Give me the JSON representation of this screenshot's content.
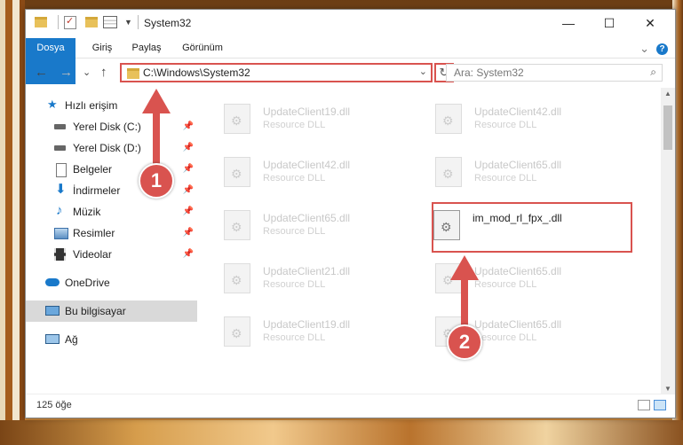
{
  "window": {
    "title": "System32",
    "minimize": "—",
    "maximize": "☐",
    "close": "✕"
  },
  "ribbon": {
    "tabs": [
      "Dosya",
      "Giriş",
      "Paylaş",
      "Görünüm"
    ],
    "expand": "⌄",
    "help": "?"
  },
  "nav": {
    "back": "←",
    "forward": "→",
    "recent": "⌄",
    "up": "↑",
    "address_path": "C:\\Windows\\System32",
    "dropdown": "⌄",
    "refresh": "↻",
    "search_placeholder": "Ara: System32",
    "search_icon": "⌕"
  },
  "sidebar": {
    "items": [
      {
        "label": "Hızlı erişim",
        "icon": "star-icon"
      },
      {
        "label": "Yerel Disk (C:)",
        "icon": "drive-icon",
        "pinned": true
      },
      {
        "label": "Yerel Disk (D:)",
        "icon": "drive-icon",
        "pinned": true
      },
      {
        "label": "Belgeler",
        "icon": "documents-icon",
        "pinned": true
      },
      {
        "label": "İndirmeler",
        "icon": "download-icon",
        "pinned": true
      },
      {
        "label": "Müzik",
        "icon": "music-icon",
        "pinned": true
      },
      {
        "label": "Resimler",
        "icon": "pictures-icon",
        "pinned": true
      },
      {
        "label": "Videolar",
        "icon": "videos-icon",
        "pinned": true
      },
      {
        "label": "OneDrive",
        "icon": "cloud-icon"
      },
      {
        "label": "Bu bilgisayar",
        "icon": "computer-icon",
        "selected": true
      },
      {
        "label": "Ağ",
        "icon": "network-icon"
      }
    ],
    "pin_glyph": "📌"
  },
  "files": [
    {
      "name": "UpdateClient19.dll",
      "type": "Resource DLL"
    },
    {
      "name": "UpdateClient42.dll",
      "type": "Resource DLL"
    },
    {
      "name": "UpdateClient42.dll",
      "type": "Resource DLL"
    },
    {
      "name": "UpdateClient65.dll",
      "type": "Resource DLL"
    },
    {
      "name": "UpdateClient65.dll",
      "type": "Resource DLL"
    },
    {
      "name": "im_mod_rl_fpx_.dll",
      "type": "",
      "highlighted": true
    },
    {
      "name": "UpdateClient21.dll",
      "type": "Resource DLL"
    },
    {
      "name": "UpdateClient65.dll",
      "type": "Resource DLL"
    },
    {
      "name": "UpdateClient19.dll",
      "type": "Resource DLL"
    },
    {
      "name": "UpdateClient65.dll",
      "type": "Resource DLL"
    }
  ],
  "status": {
    "count": "125 öğe"
  },
  "annotations": {
    "badge1": "1",
    "badge2": "2",
    "color": "#d9534f"
  }
}
